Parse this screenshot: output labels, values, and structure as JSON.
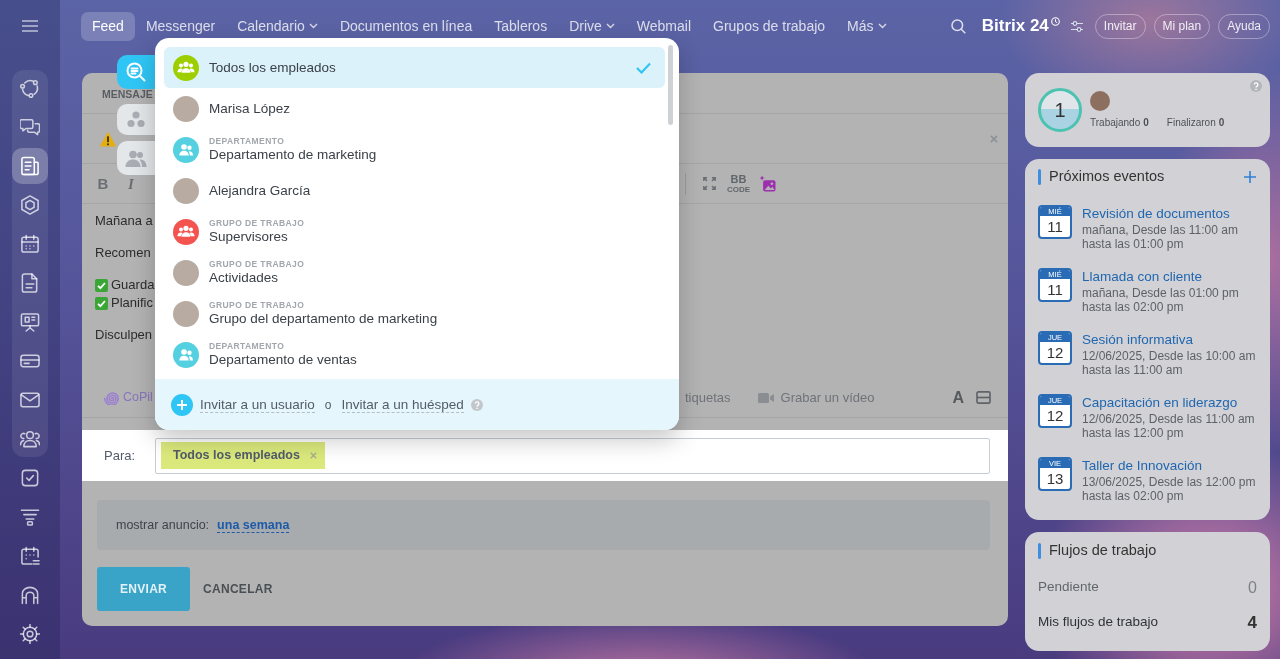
{
  "top_bar": {
    "menu": [
      {
        "label": "Feed",
        "selected": true,
        "has_menu": false
      },
      {
        "label": "Messenger",
        "selected": false,
        "has_menu": false
      },
      {
        "label": "Calendario",
        "selected": false,
        "has_menu": true
      },
      {
        "label": "Documentos en línea",
        "selected": false,
        "has_menu": false
      },
      {
        "label": "Tableros",
        "selected": false,
        "has_menu": false
      },
      {
        "label": "Drive",
        "selected": false,
        "has_menu": true
      },
      {
        "label": "Webmail",
        "selected": false,
        "has_menu": false
      },
      {
        "label": "Grupos de trabajo",
        "selected": false,
        "has_menu": false
      },
      {
        "label": "Más",
        "selected": false,
        "has_menu": true
      }
    ],
    "logo": "Bitrix 24",
    "buttons": [
      "Invitar",
      "Mi plan",
      "Ayuda"
    ]
  },
  "sidebar": {
    "pinned": [
      {
        "selected": false
      },
      {
        "selected": false
      },
      {
        "selected": true
      },
      {
        "selected": false
      },
      {
        "selected": false
      },
      {
        "selected": false
      },
      {
        "selected": false
      },
      {
        "selected": false
      },
      {
        "selected": false
      },
      {
        "selected": false
      }
    ],
    "more": [
      {
        "selected": false
      },
      {
        "selected": false
      },
      {
        "selected": false
      },
      {
        "selected": false
      },
      {
        "selected": false
      }
    ]
  },
  "post_form": {
    "tab": "MENSAJE",
    "toolbar": {
      "bold": "B",
      "italic": "I",
      "bbcode": "BB",
      "bbcode_caption": "CODE"
    },
    "lines": [
      {
        "kind": "paragraph",
        "text": "Mañana a"
      },
      {
        "kind": "paragraph",
        "text": "Recomen"
      },
      {
        "kind": "check",
        "text": "Guarda"
      },
      {
        "kind": "check",
        "text": "Planific"
      },
      {
        "kind": "paragraph",
        "text": "Disculpen"
      }
    ],
    "bottom_toolbar": {
      "copilot": "CoPil",
      "tags": "tiquetas",
      "video": "Grabar un vídeo",
      "font": "A"
    },
    "recipients": {
      "label": "Para:",
      "tags": [
        "Todos los empleados"
      ]
    },
    "announcement": {
      "label": "mostrar anuncio:",
      "value": "una semana"
    },
    "submit": "ENVIAR",
    "cancel": "CANCELAR"
  },
  "side_tools": [
    {
      "selected": true
    },
    {
      "selected": false
    },
    {
      "selected": false
    }
  ],
  "recipient_menu": {
    "items": [
      {
        "kind": "team",
        "color": "#9dcf00",
        "name": "Todos los empleados",
        "selected": true
      },
      {
        "kind": "photo",
        "name": "Marisa López",
        "selected": false
      },
      {
        "kind": "department",
        "color": "#55d0e0",
        "caption": "DEPARTAMENTO",
        "name": "Departamento de marketing",
        "selected": false
      },
      {
        "kind": "photo",
        "name": "Alejandra García",
        "selected": false
      },
      {
        "kind": "team",
        "color": "#f4544f",
        "caption": "GRUPO DE TRABAJO",
        "name": "Supervisores",
        "selected": false
      },
      {
        "kind": "photo",
        "caption": "GRUPO DE TRABAJO",
        "name": "Actividades",
        "selected": false
      },
      {
        "kind": "photo",
        "caption": "GRUPO DE TRABAJO",
        "name": "Grupo del departamento de marketing",
        "selected": false
      },
      {
        "kind": "department",
        "color": "#55d0e0",
        "caption": "DEPARTAMENTO",
        "name": "Departamento de ventas",
        "selected": false
      }
    ],
    "invite_user": "Invitar a un usuario",
    "separator": "o",
    "invite_guest": "Invitar a un huésped"
  },
  "work_day": {
    "count": "1",
    "stats": [
      {
        "label": "Trabajando",
        "value": "0"
      },
      {
        "label": "Finalizaron",
        "value": "0"
      }
    ]
  },
  "events": {
    "title": "Próximos eventos",
    "items": [
      {
        "weekday": "MIÉ",
        "day": "11",
        "title": "Revisión de documentos",
        "time": "mañana, Desde las 11:00 am hasta las 01:00 pm"
      },
      {
        "weekday": "MIÉ",
        "day": "11",
        "title": "Llamada con cliente",
        "time": "mañana, Desde las 01:00 pm hasta las 02:00 pm"
      },
      {
        "weekday": "JUE",
        "day": "12",
        "title": "Sesión informativa",
        "time": "12/06/2025, Desde las 10:00 am hasta las 11:00 am"
      },
      {
        "weekday": "JUE",
        "day": "12",
        "title": "Capacitación en liderazgo",
        "time": "12/06/2025, Desde las 11:00 am hasta las 12:00 pm"
      },
      {
        "weekday": "VIE",
        "day": "13",
        "title": "Taller de Innovación",
        "time": "13/06/2025, Desde las 12:00 pm hasta las 02:00 pm"
      }
    ]
  },
  "workflows": {
    "title": "Flujos de trabajo",
    "rows": [
      {
        "kind": "muted",
        "label": "Pendiente",
        "value": "0"
      },
      {
        "kind": "strong",
        "label": "Mis flujos de trabajo",
        "value": "4"
      }
    ]
  }
}
